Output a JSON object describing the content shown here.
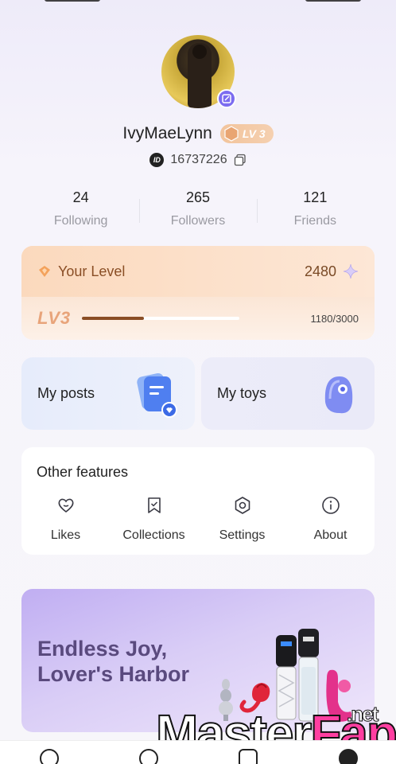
{
  "profile": {
    "username": "IvyMaeLynn",
    "level_badge": "LV 3",
    "user_id": "16737226",
    "avatar_icon": "user-avatar",
    "edit_icon": "edit-icon"
  },
  "stats": [
    {
      "value": "24",
      "label": "Following"
    },
    {
      "value": "265",
      "label": "Followers"
    },
    {
      "value": "121",
      "label": "Friends"
    }
  ],
  "level": {
    "title": "Your Level",
    "points": "2480",
    "lv_label": "LV3",
    "progress_text": "1180/3000",
    "progress_fraction": 0.393
  },
  "tiles": {
    "posts": "My posts",
    "toys": "My toys"
  },
  "features": {
    "title": "Other features",
    "items": [
      {
        "label": "Likes",
        "icon": "heart-icon"
      },
      {
        "label": "Collections",
        "icon": "bookmark-icon"
      },
      {
        "label": "Settings",
        "icon": "settings-icon"
      },
      {
        "label": "About",
        "icon": "info-icon"
      }
    ]
  },
  "banner": {
    "line1": "Endless Joy,",
    "line2": "Lover's Harbor"
  },
  "watermark": {
    "part1": "Master",
    "part2": "Fap",
    "tld": ".net"
  },
  "colors": {
    "accent": "#7c6cf0",
    "level_brown": "#8a4e25",
    "banner_text": "#5a4a7e",
    "watermark_pink": "#ff3ea1"
  }
}
